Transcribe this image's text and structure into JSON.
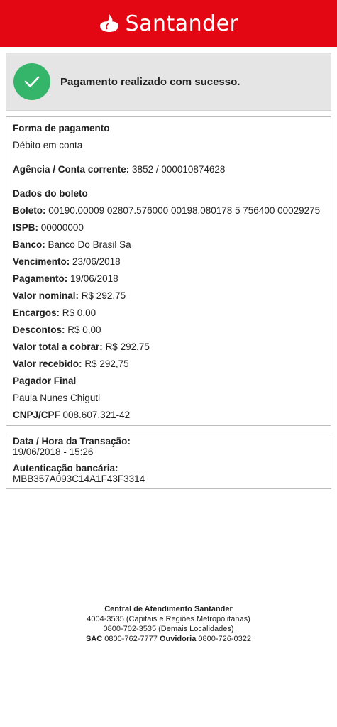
{
  "header": {
    "brand_name": "Santander",
    "logo_icon": "santander-flame-icon",
    "bg_color": "#e30613"
  },
  "status": {
    "message": "Pagamento realizado com sucesso.",
    "icon": "check-icon",
    "color": "#35b56a"
  },
  "payment": {
    "method_label": "Forma de pagamento",
    "method_value": "Débito em conta",
    "account_label": "Agência / Conta corrente:",
    "account_value": "3852 / 000010874628"
  },
  "boleto": {
    "section_title": "Dados do boleto",
    "fields": [
      {
        "label": "Boleto:",
        "value": "00190.00009 02807.576000 00198.080178 5 756400 00029275"
      },
      {
        "label": "ISPB:",
        "value": "00000000"
      },
      {
        "label": "Banco:",
        "value": "Banco Do Brasil Sa"
      },
      {
        "label": "Vencimento:",
        "value": "23/06/2018"
      },
      {
        "label": "Pagamento:",
        "value": "19/06/2018"
      },
      {
        "label": "Valor nominal:",
        "value": "R$ 292,75"
      },
      {
        "label": "Encargos:",
        "value": "R$ 0,00"
      },
      {
        "label": "Descontos:",
        "value": "R$ 0,00"
      },
      {
        "label": "Valor total a cobrar:",
        "value": "R$ 292,75"
      },
      {
        "label": "Valor recebido:",
        "value": "R$ 292,75"
      }
    ],
    "payer_title": "Pagador Final",
    "payer_name": "Paula Nunes Chiguti",
    "cpf_label": "CNPJ/CPF",
    "cpf_value": "008.607.321-42"
  },
  "transaction": {
    "datetime_label": "Data / Hora da Transação:",
    "datetime_value": "19/06/2018 - 15:26",
    "auth_label": "Autenticação bancária:",
    "auth_value": "MBB357A093C14A1F43F3314"
  },
  "footer": {
    "title": "Central de Atendimento Santander",
    "line1": "4004-3535 (Capitais e Regiões Metropolitanas)",
    "line2": "0800-702-3535 (Demais Localidades)",
    "sac_label": "SAC",
    "sac_value": "0800-762-7777",
    "ouvidoria_label": "Ouvidoria",
    "ouvidoria_value": "0800-726-0322"
  }
}
